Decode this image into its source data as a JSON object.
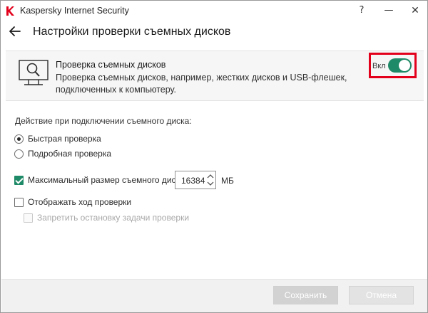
{
  "window": {
    "title": "Kaspersky Internet Security",
    "help_label": "?",
    "minimize_label": "—",
    "close_label": "✕"
  },
  "header": {
    "title": "Настройки проверки съемных дисков"
  },
  "feature": {
    "title": "Проверка съемных дисков",
    "description_line1": "Проверка съемных дисков, например, жестких дисков и USB-флешек,",
    "description_line2": "подключенных к компьютеру.",
    "toggle_label": "Вкл",
    "enabled": true
  },
  "settings": {
    "action_label": "Действие при подключении съемного диска:",
    "options": [
      {
        "label": "Быстрая проверка",
        "selected": true
      },
      {
        "label": "Подробная проверка",
        "selected": false
      }
    ],
    "max_size": {
      "label": "Максимальный размер съемного диска:",
      "checked": true,
      "value": "16384",
      "unit": "МБ"
    },
    "show_progress": {
      "label": "Отображать ход проверки",
      "checked": false
    },
    "prevent_stop": {
      "label": "Запретить остановку задачи проверки",
      "checked": false,
      "disabled": true
    }
  },
  "footer": {
    "save_label": "Сохранить",
    "cancel_label": "Отмена"
  },
  "colors": {
    "accent": "#1f8a67",
    "highlight": "#e3001b",
    "logo": "#e3001b"
  },
  "icons": {
    "logo": "kaspersky-logo",
    "back": "back-arrow-icon",
    "feature": "monitor-magnifier-icon"
  }
}
